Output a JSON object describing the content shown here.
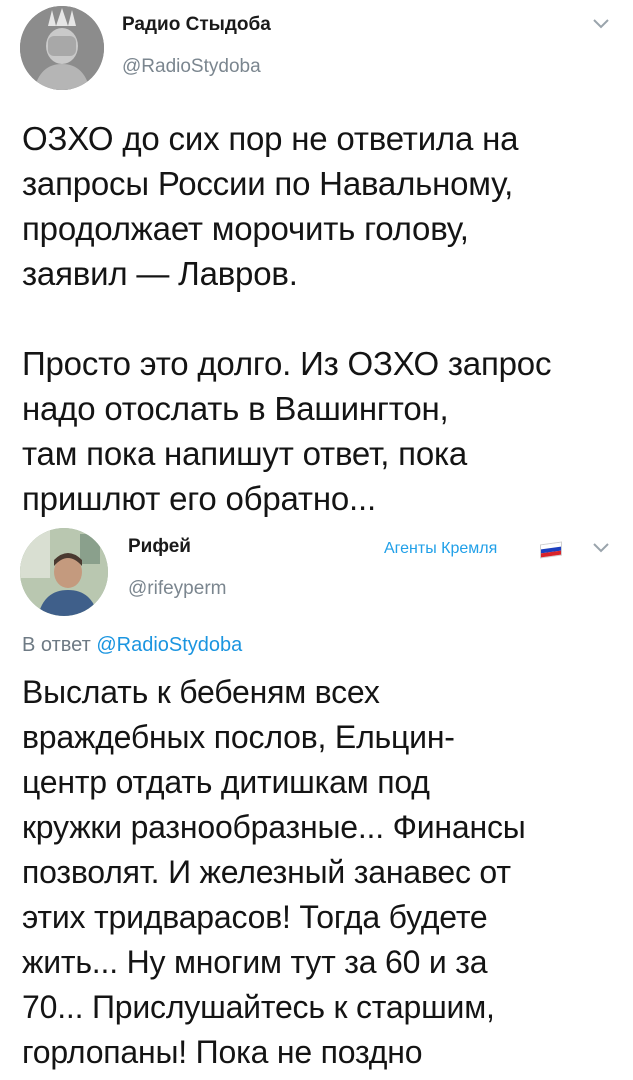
{
  "tweet1": {
    "display_name": "Радио Стыдоба",
    "handle": "@RadioStydoba",
    "text": "ОЗХО до сих пор не ответила на\nзапросы России по Навальному,\nпродолжает морочить голову,\nзаявил — Лавров.\n\nПросто это долго. Из ОЗХО запрос\nнадо отослать в Вашингтон,\nтам пока напишут ответ, пока\nпришлют его обратно..."
  },
  "tweet2": {
    "display_name": "Рифей",
    "handle": "@rifeyperm",
    "label": "Агенты Кремля",
    "reply_prefix": "В ответ",
    "reply_handle": "@RadioStydoba",
    "text": "Выслать к бебеням всех\nвраждебных послов, Ельцин-\nцентр отдать дитишкам под\nкружки разнообразные... Финансы\nпозволят. И железный занавес от\nэтих тридварасов! Тогда будете\nжить... Ну многим тут за 60 и за\n70... Прислушайтесь к старшим,\nгорлопаны! Пока не поздно"
  },
  "icons": {
    "tweet1_menu": "chevron-down-icon",
    "tweet2_menu": "chevron-down-icon",
    "flag": "russia-flag-icon"
  },
  "colors": {
    "link": "#1b95e0",
    "muted": "#7b868f",
    "label": "#21a0e8"
  }
}
